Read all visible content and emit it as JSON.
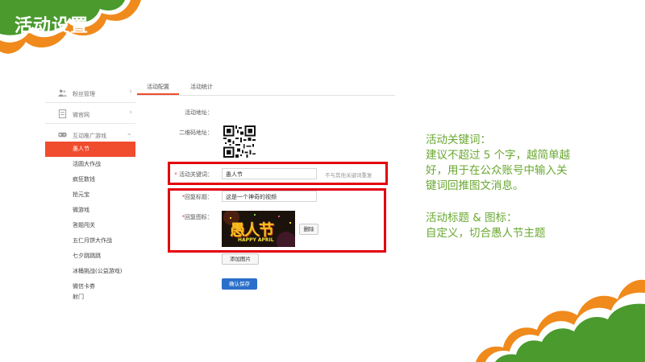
{
  "slide": {
    "title": "活动设置"
  },
  "sidebar": {
    "groups": [
      {
        "label": "粉丝管理",
        "icon": "users-icon"
      },
      {
        "label": "微官网",
        "icon": "document-icon"
      },
      {
        "label": "互动推广游戏",
        "icon": "gamepad-icon"
      }
    ],
    "items": [
      {
        "label": "愚人节"
      },
      {
        "label": "活圆大作战"
      },
      {
        "label": "疯狂数钱"
      },
      {
        "label": "抢元宝"
      },
      {
        "label": "微游戏"
      },
      {
        "label": "答题闯关"
      },
      {
        "label": "五仁月饼大作战"
      },
      {
        "label": "七夕跳跳跳"
      },
      {
        "label": "冰桶挑战(公益游戏)"
      },
      {
        "label": "微信卡券"
      },
      {
        "label": "射门"
      }
    ]
  },
  "tabs": [
    {
      "label": "活动配置"
    },
    {
      "label": "活动统计"
    }
  ],
  "form": {
    "address_label": "活动地址：",
    "qr_label": "二维码地址：",
    "keyword_label": "活动关键词：",
    "keyword_value": "愚人节",
    "keyword_hint": "不与其他关键词重复",
    "reply_title_label": "回复标题：",
    "reply_title_value": "这是一个神奇的视频",
    "reply_image_label": "回复图标：",
    "delete_button": "删除",
    "add_image_button": "添加图片",
    "save_button": "确认保存"
  },
  "poster": {
    "headline": "愚人节",
    "subline": "HAPPY APRIL"
  },
  "notes": {
    "keyword": [
      "活动关键词：",
      "建议不超过 5 个字，越简单越",
      "好，用于在公众账号中输入关",
      "键词回推图文消息。"
    ],
    "title_icon": [
      "活动标题 & 图标：",
      "自定义，切合愚人节主题"
    ]
  },
  "colors": {
    "accent_green": "#6aa832",
    "dark_green": "#3e8a2a",
    "orange": "#f08a1c",
    "red_box": "#e4000e",
    "active_item": "#f04c2e",
    "primary_button": "#2a6fc9"
  }
}
